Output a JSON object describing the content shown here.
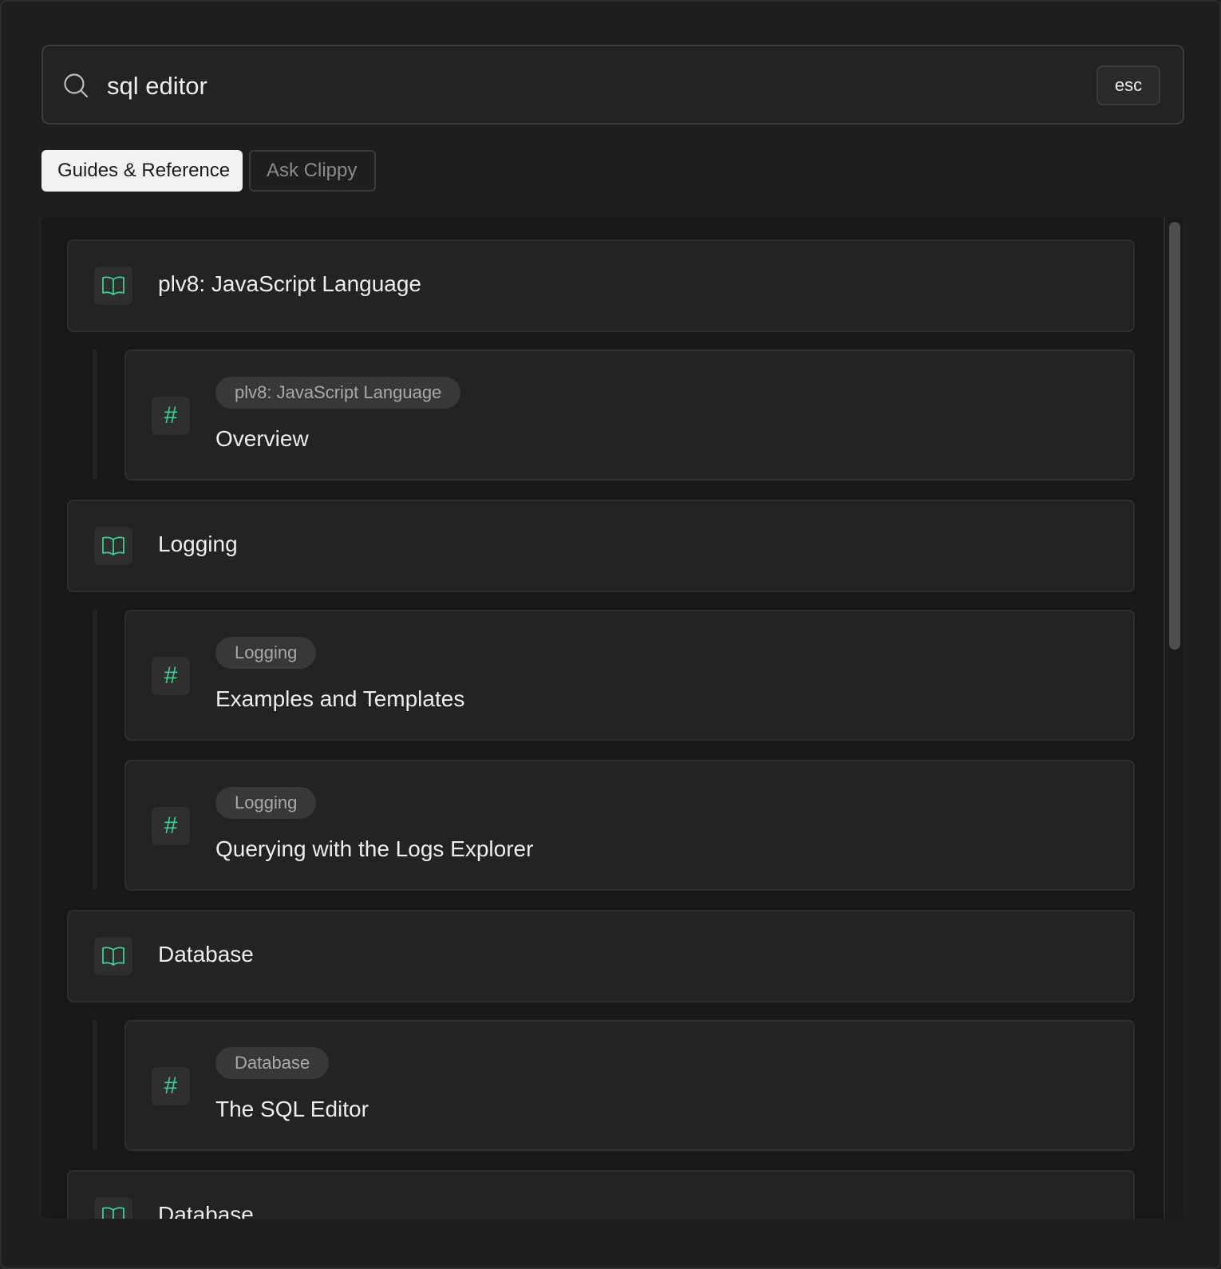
{
  "search": {
    "value": "sql editor",
    "esc_label": "esc"
  },
  "tabs": [
    {
      "label": "Guides & Reference",
      "active": true
    },
    {
      "label": "Ask Clippy",
      "active": false
    }
  ],
  "colors": {
    "accent": "#3ecf8e",
    "background": "#1f1f1f",
    "card": "#232323"
  },
  "results": [
    {
      "title": "plv8: JavaScript Language",
      "icon": "book-icon",
      "sections": [
        {
          "badge": "plv8: JavaScript Language",
          "title": "Overview",
          "icon": "hash-icon"
        }
      ]
    },
    {
      "title": "Logging",
      "icon": "book-icon",
      "sections": [
        {
          "badge": "Logging",
          "title": "Examples and Templates",
          "icon": "hash-icon"
        },
        {
          "badge": "Logging",
          "title": "Querying with the Logs Explorer",
          "icon": "hash-icon"
        }
      ]
    },
    {
      "title": "Database",
      "icon": "book-icon",
      "sections": [
        {
          "badge": "Database",
          "title": "The SQL Editor",
          "icon": "hash-icon"
        }
      ]
    },
    {
      "title": "Database",
      "icon": "book-icon",
      "sections": []
    }
  ]
}
